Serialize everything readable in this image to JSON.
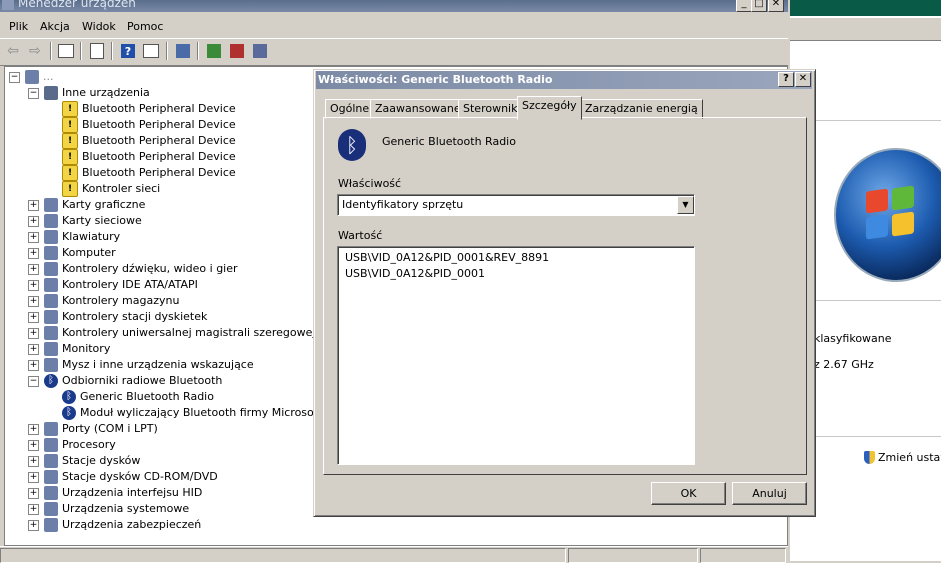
{
  "main_window": {
    "title": "Menedżer urządzeń",
    "menu": [
      "Plik",
      "Akcja",
      "Widok",
      "Pomoc"
    ]
  },
  "tree": {
    "root_label": "...",
    "items": [
      {
        "label": "Inne urządzenia",
        "level": 1,
        "expanded": true,
        "icon": "unknown-device-icon"
      },
      {
        "label": "Bluetooth Peripheral Device",
        "level": 2,
        "icon": "warning-device-icon"
      },
      {
        "label": "Bluetooth Peripheral Device",
        "level": 2,
        "icon": "warning-device-icon"
      },
      {
        "label": "Bluetooth Peripheral Device",
        "level": 2,
        "icon": "warning-device-icon"
      },
      {
        "label": "Bluetooth Peripheral Device",
        "level": 2,
        "icon": "warning-device-icon"
      },
      {
        "label": "Bluetooth Peripheral Device",
        "level": 2,
        "icon": "warning-device-icon"
      },
      {
        "label": "Kontroler sieci",
        "level": 2,
        "icon": "warning-device-icon"
      },
      {
        "label": "Karty graficzne",
        "level": 1,
        "expanded": false,
        "icon": "display-adapter-icon"
      },
      {
        "label": "Karty sieciowe",
        "level": 1,
        "expanded": false,
        "icon": "network-adapter-icon"
      },
      {
        "label": "Klawiatury",
        "level": 1,
        "expanded": false,
        "icon": "keyboard-icon"
      },
      {
        "label": "Komputer",
        "level": 1,
        "expanded": false,
        "icon": "computer-icon"
      },
      {
        "label": "Kontrolery dźwięku, wideo i gier",
        "level": 1,
        "expanded": false,
        "icon": "speaker-icon"
      },
      {
        "label": "Kontrolery IDE ATA/ATAPI",
        "level": 1,
        "expanded": false,
        "icon": "ide-controller-icon"
      },
      {
        "label": "Kontrolery magazynu",
        "level": 1,
        "expanded": false,
        "icon": "storage-controller-icon"
      },
      {
        "label": "Kontrolery stacji dyskietek",
        "level": 1,
        "expanded": false,
        "icon": "floppy-controller-icon"
      },
      {
        "label": "Kontrolery uniwersalnej magistrali szeregowej",
        "level": 1,
        "expanded": false,
        "icon": "usb-icon"
      },
      {
        "label": "Monitory",
        "level": 1,
        "expanded": false,
        "icon": "monitor-icon"
      },
      {
        "label": "Mysz i inne urządzenia wskazujące",
        "level": 1,
        "expanded": false,
        "icon": "mouse-icon"
      },
      {
        "label": "Odbiorniki radiowe Bluetooth",
        "level": 1,
        "expanded": true,
        "icon": "bluetooth-icon"
      },
      {
        "label": "Generic Bluetooth Radio",
        "level": 2,
        "icon": "bluetooth-icon"
      },
      {
        "label": "Moduł wyliczający Bluetooth firmy Microsoft",
        "level": 2,
        "icon": "bluetooth-icon"
      },
      {
        "label": "Porty (COM i LPT)",
        "level": 1,
        "expanded": false,
        "icon": "port-icon"
      },
      {
        "label": "Procesory",
        "level": 1,
        "expanded": false,
        "icon": "processor-icon"
      },
      {
        "label": "Stacje dysków",
        "level": 1,
        "expanded": false,
        "icon": "disk-drive-icon"
      },
      {
        "label": "Stacje dysków CD-ROM/DVD",
        "level": 1,
        "expanded": false,
        "icon": "cdrom-icon"
      },
      {
        "label": "Urządzenia interfejsu HID",
        "level": 1,
        "expanded": false,
        "icon": "hid-icon"
      },
      {
        "label": "Urządzenia systemowe",
        "level": 1,
        "expanded": false,
        "icon": "system-device-icon"
      },
      {
        "label": "Urządzenia zabezpieczeń",
        "level": 1,
        "expanded": false,
        "icon": "security-device-icon"
      }
    ]
  },
  "background_window": {
    "text_classification": "klasyfikowane",
    "text_speed": "z  2.67 GHz",
    "change_settings": "Zmień ustawi"
  },
  "dialog": {
    "title": "Właściwości: Generic Bluetooth Radio",
    "help_button": "?",
    "close_button": "✕",
    "tabs": [
      "Ogólne",
      "Zaawansowane",
      "Sterownik",
      "Szczegóły",
      "Zarządzanie energią"
    ],
    "active_tab": "Szczegóły",
    "device_name": "Generic Bluetooth Radio",
    "property_label": "Właściwość",
    "property_value": "Identyfikatory sprzętu",
    "value_label": "Wartość",
    "values": [
      "USB\\VID_0A12&PID_0001&REV_8891",
      "USB\\VID_0A12&PID_0001"
    ],
    "ok_label": "OK",
    "cancel_label": "Anuluj"
  },
  "colors": {
    "dialog_title": "#8a97b0",
    "window_face": "#d4d0c8",
    "bluetooth": "#1a2f7a"
  }
}
